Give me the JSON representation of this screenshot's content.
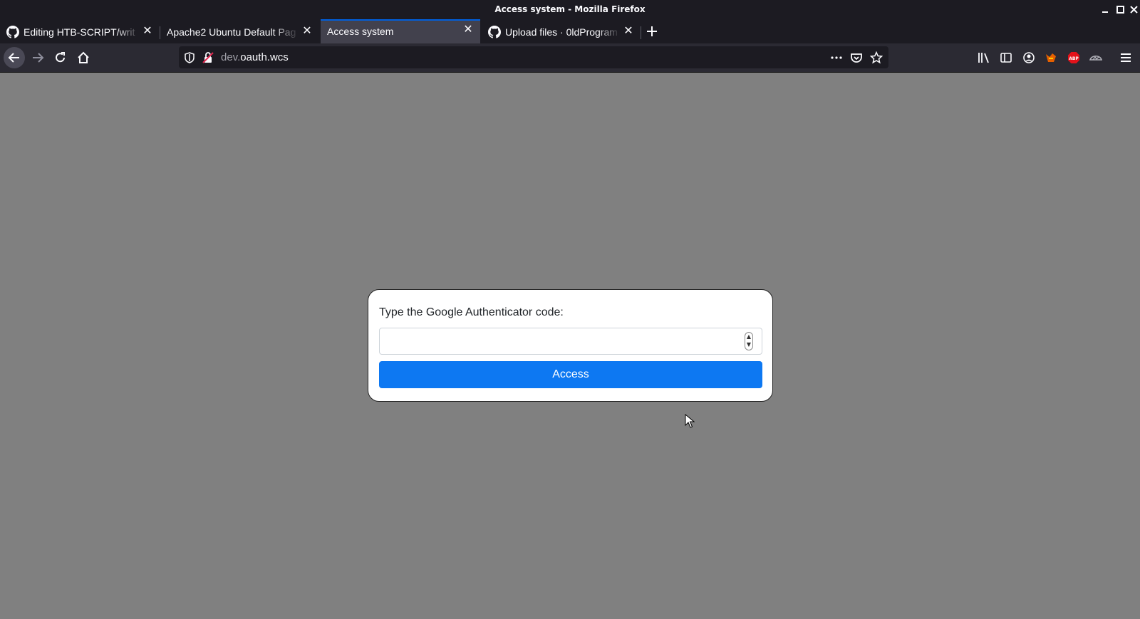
{
  "window": {
    "title": "Access system - Mozilla Firefox"
  },
  "tabs": [
    {
      "label": "Editing HTB-SCRIPT/writ",
      "icon": "github-icon",
      "active": false
    },
    {
      "label": "Apache2 Ubuntu Default Pag",
      "icon": "none",
      "active": false
    },
    {
      "label": "Access system",
      "icon": "none",
      "active": true
    },
    {
      "label": "Upload files · 0ldProgram",
      "icon": "github-icon",
      "active": false
    }
  ],
  "urlbar": {
    "prefix": "dev.",
    "domain": "oauth.wcs"
  },
  "dialog": {
    "prompt": "Type the Google Authenticator code:",
    "code_value": "",
    "button_label": "Access"
  },
  "colors": {
    "page_background": "#808080",
    "accent": "#0d78f2",
    "active_tab_border": "#0060df"
  }
}
